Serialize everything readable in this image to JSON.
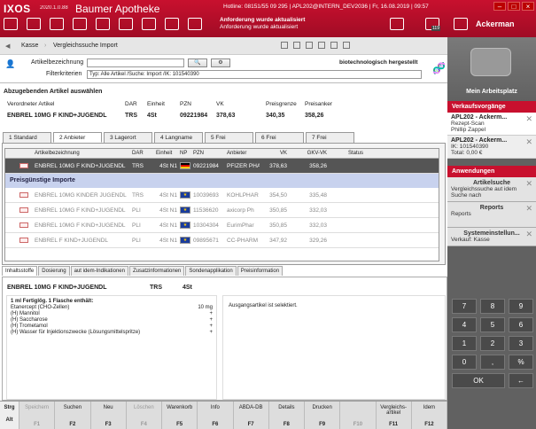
{
  "titlebar": {
    "logo": "IXOS",
    "version": "2020.1.0.88",
    "app_name": "Baumer Apotheke",
    "hotline": "Hotline: 08151/55 09 295  |  APL202@INTERN_DEV2036  |  Fr, 16.08.2019  |  09:57",
    "notif_title": "Anforderung wurde aktualisiert",
    "notif_text": "Anforderung wurde aktualisiert",
    "user": "Ackerman",
    "badge_count": "119"
  },
  "breadcrumb": {
    "home": "Kasse",
    "current": "Vergleichssuche Import"
  },
  "search": {
    "field_label": "Artikelbezeichnung",
    "filter_label": "Filterkriterien",
    "filter_value": "Typ: Alle Artikel /Suche: Import /IK: 101540390",
    "tag": "biotechnologisch hergestellt"
  },
  "prescribed": {
    "section_title": "Abzugebenden Artikel auswählen",
    "col_name": "Verordneter Artikel",
    "col_dar": "DAR",
    "col_unit": "Einheit",
    "col_pzn": "PZN",
    "col_vk": "VK",
    "col_limit": "Preisgrenze",
    "col_anchor": "Preisanker",
    "name": "ENBREL 10MG F KIND+JUGENDL",
    "dar": "TRS",
    "unit": "4St",
    "pzn": "09221984",
    "vk": "378,63",
    "limit": "340,35",
    "anchor": "358,26"
  },
  "tabs": [
    {
      "label": "1 Standard"
    },
    {
      "label": "2 Anbieter"
    },
    {
      "label": "3 Lagerort"
    },
    {
      "label": "4 Langname"
    },
    {
      "label": "5 Frei"
    },
    {
      "label": "6 Frei"
    },
    {
      "label": "7 Frei"
    }
  ],
  "grid": {
    "headers": [
      "Artikelbezeichnung",
      "DAR",
      "Einheit",
      "NP",
      "PZN",
      "Anbieter",
      "VK",
      "GKV-VK",
      "Status"
    ],
    "selected": {
      "name": "ENBREL 10MG F KIND+JUGENDL",
      "dar": "TRS",
      "unit": "4St N1",
      "pzn": "09221984",
      "vendor": "PFIZER PHA",
      "vk": "378,63",
      "gkv": "358,26"
    },
    "group_label": "Preisgünstige Importe",
    "rows": [
      {
        "name": "ENBREL 10MG KINDER JUGENDL",
        "dar": "TRS",
        "unit": "4St N1",
        "pzn": "10039693",
        "vendor": "KOHLPHAR",
        "vk": "354,50",
        "gkv": "335,48"
      },
      {
        "name": "ENBREL 10MG F KIND+JUGENDL",
        "dar": "PLI",
        "unit": "4St N1",
        "pzn": "11536620",
        "vendor": "axicorp Ph",
        "vk": "350,85",
        "gkv": "332,03"
      },
      {
        "name": "ENBREL 10MG F KIND+JUGENDL",
        "dar": "PLI",
        "unit": "4St N1",
        "pzn": "10304304",
        "vendor": "EurimPhar",
        "vk": "350,85",
        "gkv": "332,03"
      },
      {
        "name": "ENBREL F KIND+JUGENDL",
        "dar": "PLI",
        "unit": "4St N1",
        "pzn": "09895671",
        "vendor": "CC-PHARM",
        "vk": "347,92",
        "gkv": "329,26"
      }
    ]
  },
  "bottom_tabs": [
    "Inhaltsstoffe",
    "Dosierung",
    "aut idem-Indikationen",
    "Zusatzinformationen",
    "Sondenapplikation",
    "Preisinformation"
  ],
  "details": {
    "name": "ENBREL 10MG F KIND+JUGENDL",
    "dar": "TRS",
    "unit": "4St",
    "composition_title": "1 ml Fertiglög. 1 Flasche enthält:",
    "lines": [
      {
        "text": "Etanercept (CHO-Zellen)",
        "amount": "10 mg"
      },
      {
        "text": "(H) Mannitol",
        "amount": "+"
      },
      {
        "text": "(H) Saccharose",
        "amount": "+"
      },
      {
        "text": "(H) Trometamol",
        "amount": "+"
      },
      {
        "text": "(H) Wasser für Injektionszwecke (Lösungsmittelspritze)",
        "amount": "+"
      }
    ],
    "info": "Ausgangsartikel ist selektiert."
  },
  "right": {
    "workplace": "Mein Arbeitsplatz",
    "sales_header": "Verkaufsvorgänge",
    "sales": [
      {
        "title": "APL202 - Ackerm...",
        "l1": "Rezept-Scan",
        "l2": "Phillip Zappel"
      },
      {
        "title": "APL202 - Ackerm...",
        "l1": "IK: 101540390",
        "l2": "Total: 0,00 €"
      }
    ],
    "apps_header": "Anwendungen",
    "apps": [
      {
        "title": "Artikelsuche",
        "sub": "Vergleichssuche aut idem Suche nach"
      },
      {
        "title": "Reports",
        "sub": "Reports"
      },
      {
        "title": "Systemeinstellun...",
        "sub": "Verkauf: Kasse"
      }
    ]
  },
  "keypad": [
    "7",
    "8",
    "9",
    "4",
    "5",
    "6",
    "1",
    "2",
    "3",
    "0",
    ",",
    "%",
    "OK",
    "←"
  ],
  "fkeys": [
    {
      "label": "Speichern",
      "key": "F1",
      "disabled": true
    },
    {
      "label": "Suchen",
      "key": "F2"
    },
    {
      "label": "Neu",
      "key": "F3"
    },
    {
      "label": "Löschen",
      "key": "F4",
      "disabled": true
    },
    {
      "label": "Warenkorb",
      "key": "F5"
    },
    {
      "label": "Info",
      "key": "F6"
    },
    {
      "label": "ABDA-DB",
      "key": "F7"
    },
    {
      "label": "Details",
      "key": "F8"
    },
    {
      "label": "Drucken",
      "key": "F9"
    },
    {
      "label": "",
      "key": "F10",
      "disabled": true
    },
    {
      "label": "Vergleichs-artikel",
      "key": "F11"
    },
    {
      "label": "Idem",
      "key": "F12"
    }
  ],
  "mod_keys": {
    "strg": "Strg",
    "alt": "Alt"
  },
  "colors": {
    "brand": "#c8102e",
    "selected_row": "#555555",
    "group_bar": "#c8d2ee"
  }
}
